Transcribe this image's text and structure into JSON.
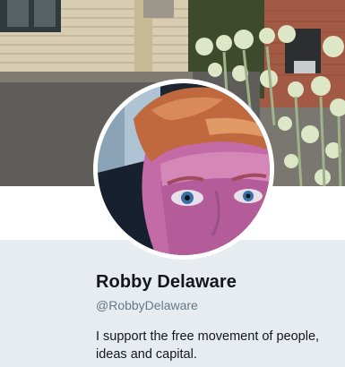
{
  "profile": {
    "display_name": "Robby Delaware",
    "handle": "@RobbyDelaware",
    "bio": "I support the free movement of people, ideas and capital."
  },
  "icons": {
    "header": "header-photo",
    "avatar": "profile-avatar-photo"
  },
  "colors": {
    "page_background": "#e6ecf0",
    "name_text": "#14171a",
    "handle_text": "#657786",
    "avatar_border": "#ffffff"
  }
}
